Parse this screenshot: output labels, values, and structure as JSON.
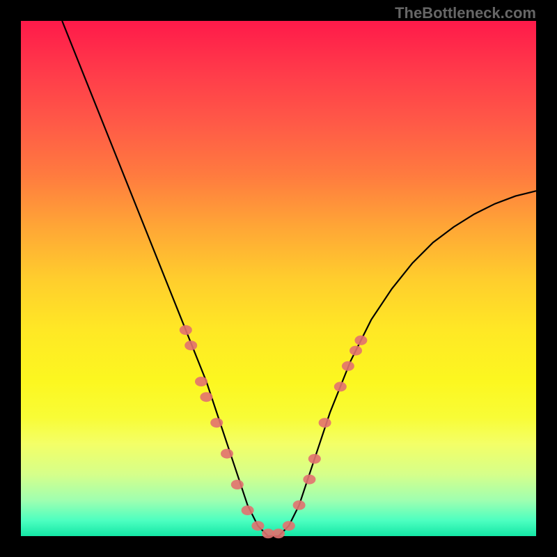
{
  "watermark": "TheBottleneck.com",
  "chart_data": {
    "type": "line",
    "title": "",
    "xlabel": "",
    "ylabel": "",
    "xlim": [
      0,
      100
    ],
    "ylim": [
      0,
      100
    ],
    "note": "Axes carry no tick labels; values below are estimated relative positions (0–100) read from pixel placement on the 740×740 plot.",
    "series": [
      {
        "name": "bottleneck-curve",
        "x": [
          8,
          12,
          16,
          20,
          24,
          28,
          30,
          32,
          34,
          36,
          38,
          40,
          42,
          44,
          46,
          48,
          50,
          52,
          54,
          56,
          60,
          64,
          68,
          72,
          76,
          80,
          84,
          88,
          92,
          96,
          100
        ],
        "y": [
          100,
          90,
          80,
          70,
          60,
          50,
          45,
          40,
          35,
          30,
          24,
          18,
          12,
          6,
          2,
          0,
          0,
          2,
          6,
          12,
          24,
          34,
          42,
          48,
          53,
          57,
          60,
          62.5,
          64.5,
          66,
          67
        ]
      }
    ],
    "markers": {
      "name": "highlight-points",
      "points": [
        {
          "x": 32,
          "y": 40
        },
        {
          "x": 33,
          "y": 37
        },
        {
          "x": 35,
          "y": 30
        },
        {
          "x": 36,
          "y": 27
        },
        {
          "x": 38,
          "y": 22
        },
        {
          "x": 40,
          "y": 16
        },
        {
          "x": 42,
          "y": 10
        },
        {
          "x": 44,
          "y": 5
        },
        {
          "x": 46,
          "y": 2
        },
        {
          "x": 48,
          "y": 0.5
        },
        {
          "x": 50,
          "y": 0.5
        },
        {
          "x": 52,
          "y": 2
        },
        {
          "x": 54,
          "y": 6
        },
        {
          "x": 56,
          "y": 11
        },
        {
          "x": 57,
          "y": 15
        },
        {
          "x": 59,
          "y": 22
        },
        {
          "x": 62,
          "y": 29
        },
        {
          "x": 63.5,
          "y": 33
        },
        {
          "x": 65,
          "y": 36
        },
        {
          "x": 66,
          "y": 38
        }
      ]
    },
    "background_gradient": {
      "direction": "top-to-bottom",
      "stops": [
        {
          "pos": 0,
          "color": "#ff1a4a"
        },
        {
          "pos": 50,
          "color": "#ffcd2d"
        },
        {
          "pos": 82,
          "color": "#f4ff66"
        },
        {
          "pos": 100,
          "color": "#14e7a6"
        }
      ]
    }
  }
}
